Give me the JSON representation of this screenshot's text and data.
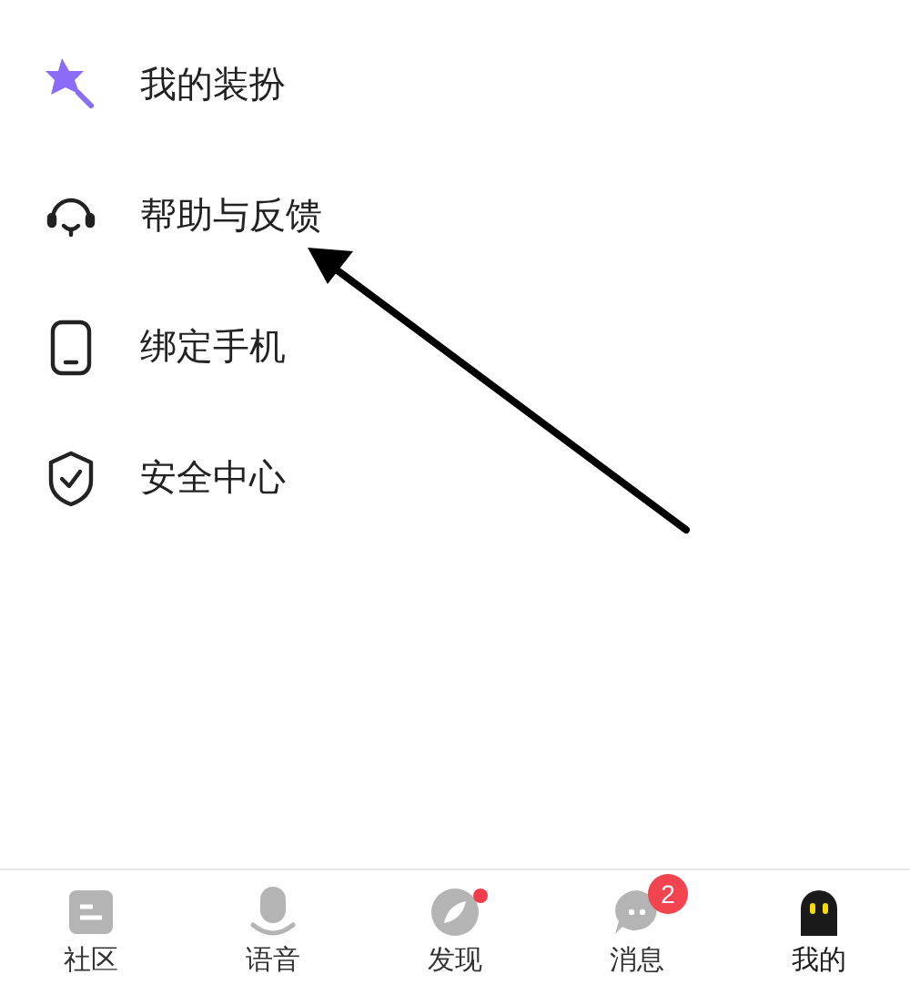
{
  "menu": [
    {
      "kind": "dressup",
      "label": "我的装扮"
    },
    {
      "kind": "help",
      "label": "帮助与反馈"
    },
    {
      "kind": "phone",
      "label": "绑定手机"
    },
    {
      "kind": "security",
      "label": "安全中心"
    }
  ],
  "tab_bar": [
    {
      "kind": "community",
      "label": "社区",
      "selected": false,
      "dot": false
    },
    {
      "kind": "voice",
      "label": "语音",
      "selected": false,
      "dot": false
    },
    {
      "kind": "discover",
      "label": "发现",
      "selected": false,
      "dot": true
    },
    {
      "kind": "messages",
      "label": "消息",
      "selected": false,
      "dot": false,
      "badge": "2"
    },
    {
      "kind": "me",
      "label": "我的",
      "selected": true,
      "dot": false
    }
  ]
}
